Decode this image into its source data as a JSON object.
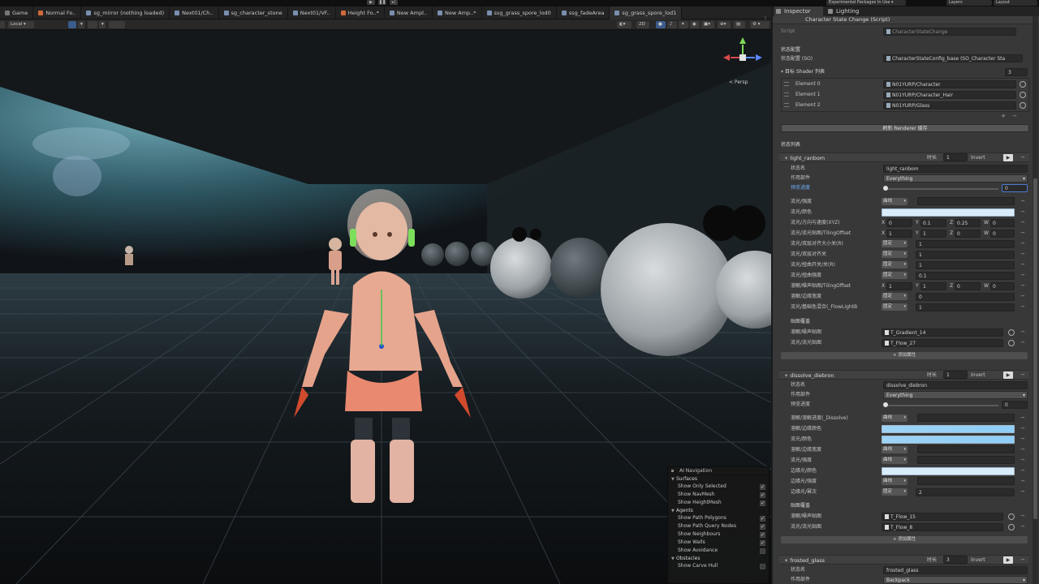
{
  "top": {
    "packages_label": "Experimental Packages In Use ▾",
    "layers_label": "Layers",
    "layout_label": "Layout"
  },
  "scene_tabs": [
    {
      "label": "Game",
      "icon": "game-icon"
    },
    {
      "label": "Normal Fo..",
      "icon": "fox-icon"
    },
    {
      "label": "sg_mirror (nothing loaded)",
      "icon": "shadergraph-icon"
    },
    {
      "label": "Next01/Ch..",
      "icon": "shadergraph-icon"
    },
    {
      "label": "sg_character_stone",
      "icon": "shadergraph-icon"
    },
    {
      "label": "Next01/VF..",
      "icon": "shadergraph-icon"
    },
    {
      "label": "Height Fo..*",
      "icon": "fox-icon"
    },
    {
      "label": "New Ampl..",
      "icon": "shadergraph-icon"
    },
    {
      "label": "New Amp..*",
      "icon": "shadergraph-icon"
    },
    {
      "label": "ssg_grass_spore_lod0",
      "icon": "shadergraph-icon"
    },
    {
      "label": "ssg_fadeArea",
      "icon": "shadergraph-icon"
    },
    {
      "label": "sg_grass_spore_lod1",
      "icon": "shadergraph-icon"
    }
  ],
  "scene_toolbar": {
    "pivot_label": "Local",
    "mode_2d": "2D"
  },
  "gizmo": {
    "persp_label": "< Persp"
  },
  "ai_nav": {
    "title": "AI Navigation",
    "sections": [
      {
        "title": "Surfaces",
        "rows": [
          {
            "label": "Show Only Selected",
            "checked": true
          },
          {
            "label": "Show NavMesh",
            "checked": true
          },
          {
            "label": "Show HeightMesh",
            "checked": true
          }
        ]
      },
      {
        "title": "Agents",
        "rows": [
          {
            "label": "Show Path Polygons",
            "checked": true
          },
          {
            "label": "Show Path Query Nodes",
            "checked": true
          },
          {
            "label": "Show Neighbours",
            "checked": true
          },
          {
            "label": "Show Walls",
            "checked": true
          },
          {
            "label": "Show Avoidance",
            "checked": false
          }
        ]
      },
      {
        "title": "Obstacles",
        "rows": [
          {
            "label": "Show Carve Hull",
            "checked": false
          }
        ]
      }
    ]
  },
  "inspector": {
    "tabs": [
      "Inspector",
      "Lighting"
    ],
    "component_title": "Character State Change (Script)",
    "script_label": "Script",
    "script_value": "CharacterStateChange",
    "config_section": "状态配置",
    "config_label": "状态配置 (SO)",
    "config_value": "CharacterStateConfig_base (SO_Character Sta",
    "shader_list_label": "目标 Shader 列表",
    "shader_count": "3",
    "shaders": [
      {
        "label": "Element 0",
        "value": "N01YURP/Character"
      },
      {
        "label": "Element 1",
        "value": "N01YURP/Character_Hair"
      },
      {
        "label": "Element 2",
        "value": "N01YURP/Glass"
      }
    ],
    "refresh_button": "刷新 Renderer 缓存",
    "states_title": "状态列表",
    "states": [
      {
        "name": "light_ranbom",
        "duration_label": "时长",
        "duration": "1",
        "invert_label": "Invert",
        "fields": {
          "name_label": "状态名",
          "name_value": "light_ranbom",
          "target_label": "作用部件",
          "target_value": "Everything",
          "preview_label": "预览进度",
          "preview_value": "0"
        },
        "props": [
          {
            "label": "流光/强度",
            "kind": "curve",
            "mode": "曲线"
          },
          {
            "label": "流光/颜色",
            "kind": "gradient"
          },
          {
            "label": "流光/方向与速度(XYZ)",
            "kind": "vec4",
            "vals": [
              "0",
              "0.1",
              "0.25",
              "0"
            ]
          },
          {
            "label": "流光/流光贴图/TilingOffset",
            "kind": "vec4",
            "vals": [
              "1",
              "1",
              "0",
              "0"
            ]
          },
          {
            "label": "流光/双层对齐大小关(R)",
            "kind": "float",
            "mode": "固定",
            "value": "1"
          },
          {
            "label": "流光/双层对齐关",
            "kind": "float",
            "mode": "固定",
            "value": "1"
          },
          {
            "label": "流光/扭曲开关/关(R)",
            "kind": "float",
            "mode": "固定",
            "value": "1"
          },
          {
            "label": "流光/扭曲强度",
            "kind": "float",
            "mode": "固定",
            "value": "0.1"
          },
          {
            "label": "溶解/噪声贴图/TilingOffset",
            "kind": "vec4",
            "vals": [
              "1",
              "1",
              "0",
              "0"
            ]
          },
          {
            "label": "溶解/边缘宽度",
            "kind": "float",
            "mode": "固定",
            "value": "0"
          },
          {
            "label": "流光/基础色混合(_FlowLightB",
            "kind": "float",
            "mode": "固定",
            "value": "1"
          }
        ],
        "tex_header": "贴图覆盖",
        "textures": [
          {
            "label": "溶解/噪声贴图",
            "value": "T_Gradient_14"
          },
          {
            "label": "流光/流光贴图",
            "value": "T_Flow_27"
          }
        ],
        "add_label": "+ 添加属性"
      },
      {
        "name": "dissolve_diebron",
        "duration_label": "时长",
        "duration": "1",
        "invert_label": "Invert",
        "fields": {
          "name_label": "状态名",
          "name_value": "dissolve_diebron",
          "target_label": "作用部件",
          "target_value": "Everything",
          "preview_label": "预览进度",
          "preview_value": "0"
        },
        "props": [
          {
            "label": "溶解/溶解进度(_Dissolve)",
            "kind": "curve",
            "mode": "曲线"
          },
          {
            "label": "溶解/边缘颜色",
            "kind": "gradient"
          },
          {
            "label": "流光/颜色",
            "kind": "gradient"
          },
          {
            "label": "溶解/边缘宽度",
            "kind": "curve",
            "mode": "曲线"
          },
          {
            "label": "流光/强度",
            "kind": "curve",
            "mode": "曲线"
          },
          {
            "label": "边缘光/颜色",
            "kind": "gradient"
          },
          {
            "label": "边缘光/强度",
            "kind": "curve",
            "mode": "曲线"
          },
          {
            "label": "边缘光/幂次",
            "kind": "float",
            "mode": "固定",
            "value": "2"
          }
        ],
        "tex_header": "贴图覆盖",
        "textures": [
          {
            "label": "溶解/噪声贴图",
            "value": "T_Flow_15"
          },
          {
            "label": "流光/流光贴图",
            "value": "T_Flow_8"
          }
        ],
        "add_label": "+ 添加属性"
      },
      {
        "name": "frosted_glass",
        "duration_label": "时长",
        "duration": "3",
        "invert_label": "Invert",
        "fields": {
          "name_label": "状态名",
          "name_value": "frosted_glass",
          "target_label": "作用部件",
          "target_value": "Backpack"
        }
      }
    ]
  },
  "colors": {
    "accent_blue": "#3b5c8c",
    "gradient_light": "#d9ecfa",
    "gradient_blue": "#8ecef7",
    "highlight_label": "#6fb0ff"
  }
}
